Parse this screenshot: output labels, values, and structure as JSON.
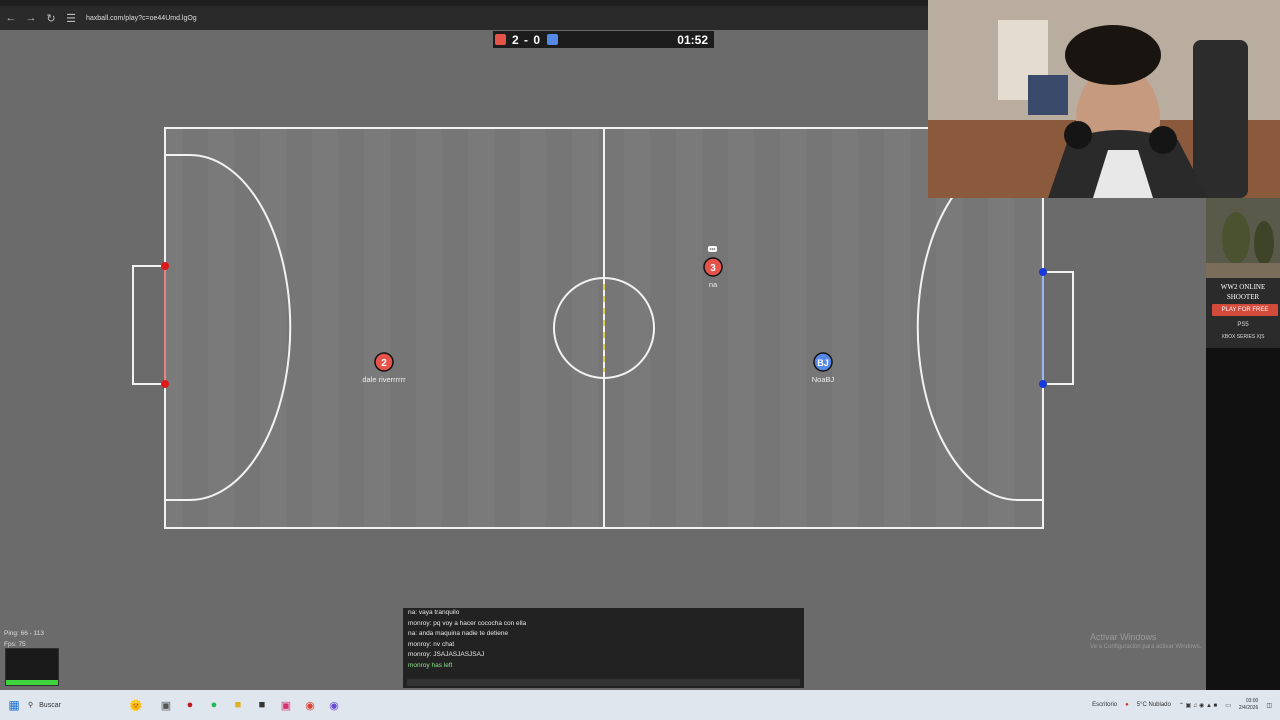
{
  "browser": {
    "url": "haxball.com/play?c=oe44Umd.lgOg",
    "back_icon": "back-arrow-icon",
    "forward_icon": "forward-arrow-icon",
    "reload_icon": "reload-icon"
  },
  "scoreboard": {
    "score": "2 - 0",
    "time": "01:52",
    "red_color": "#e5534b",
    "blue_color": "#5689e5"
  },
  "players": [
    {
      "avatar": "2",
      "name": "dale riverrrrrr",
      "team": "red"
    },
    {
      "avatar": "3",
      "name": "na",
      "team": "red"
    },
    {
      "avatar": "BJ",
      "name": "NoaBJ",
      "team": "blue"
    }
  ],
  "chat": {
    "lines": [
      {
        "text": "na: vaya tranquilo"
      },
      {
        "text": "monroy: pq voy a hacer cococha con ella"
      },
      {
        "text": "na: anda maquina nadie te detiene"
      },
      {
        "text": "monroy: nv chat"
      },
      {
        "text": "monroy: JSAJASJASJSAJ"
      },
      {
        "text": "monroy has left",
        "system": true
      }
    ]
  },
  "stats": {
    "ping": "Ping: 66 - 113",
    "fps": "Fps: 75"
  },
  "ad": {
    "title_line1": "WW2 ONLINE",
    "title_line2": "SHOOTER",
    "button": "PLAY FOR FREE",
    "ps5": "PS5",
    "xbox": "XBOX SERIES X|S"
  },
  "watermark": {
    "title": "Activar Windows",
    "subtitle": "Ve a Configuración para activar Windows."
  },
  "taskbar": {
    "search_placeholder": "Buscar",
    "desktop_label": "Escritorio",
    "weather": "5°C  Nublado",
    "time": "03:00",
    "date": "2/4/2026"
  }
}
